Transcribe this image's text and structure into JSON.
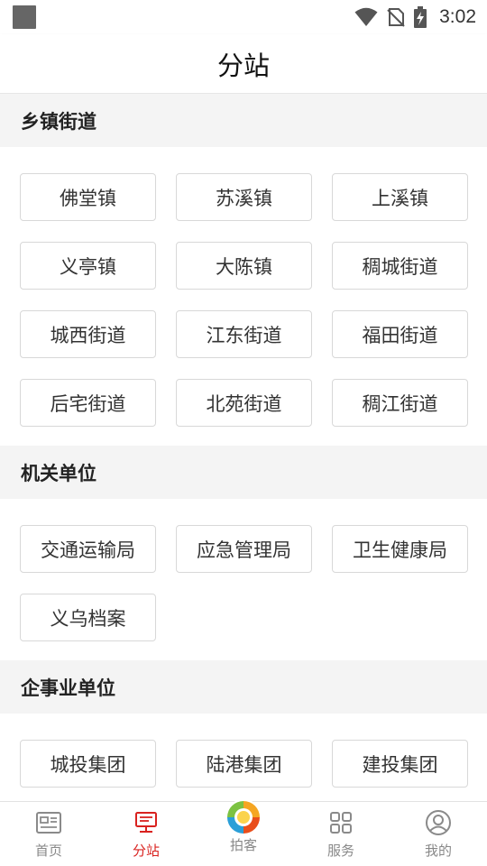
{
  "status_bar": {
    "time": "3:02"
  },
  "header": {
    "title": "分站"
  },
  "sections": [
    {
      "title": "乡镇街道",
      "items": [
        "佛堂镇",
        "苏溪镇",
        "上溪镇",
        "义亭镇",
        "大陈镇",
        "稠城街道",
        "城西街道",
        "江东街道",
        "福田街道",
        "后宅街道",
        "北苑街道",
        "稠江街道"
      ]
    },
    {
      "title": "机关单位",
      "items": [
        "交通运输局",
        "应急管理局",
        "卫生健康局",
        "义乌档案"
      ]
    },
    {
      "title": "企事业单位",
      "items": [
        "城投集团",
        "陆港集团",
        "建投集团"
      ]
    }
  ],
  "bottom_nav": {
    "items": [
      {
        "label": "首页",
        "icon": "news-icon"
      },
      {
        "label": "分站",
        "icon": "substation-icon",
        "active": true
      },
      {
        "label": "拍客",
        "icon": "paike-logo-icon"
      },
      {
        "label": "服务",
        "icon": "grid-icon"
      },
      {
        "label": "我的",
        "icon": "profile-icon"
      }
    ]
  },
  "colors": {
    "accent": "#d9221f",
    "section_bg": "#f4f4f4",
    "chip_border": "#d8d8d8"
  }
}
